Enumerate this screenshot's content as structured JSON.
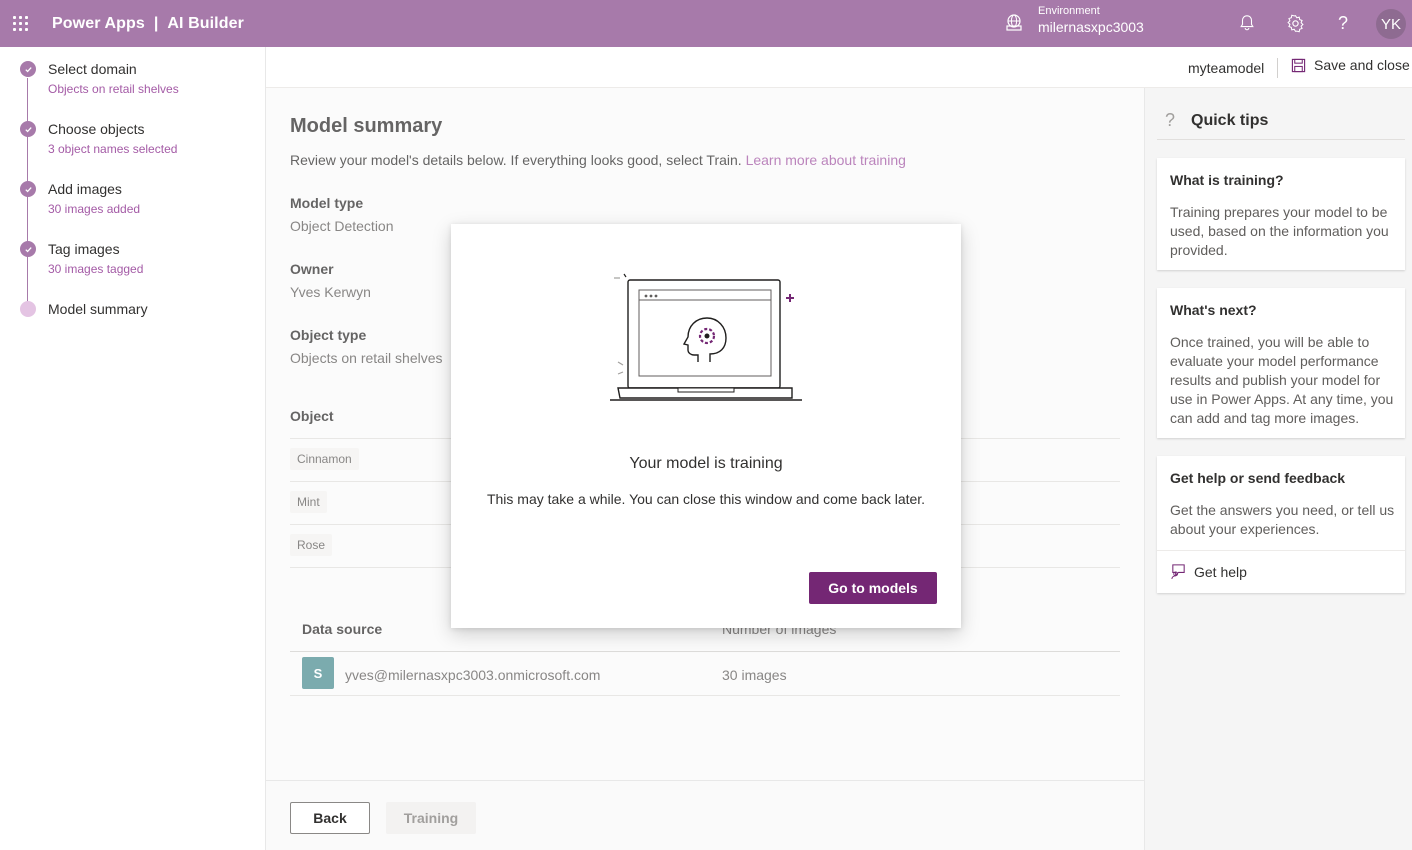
{
  "topbar": {
    "app_name": "Power Apps",
    "separator": "|",
    "product": "AI Builder",
    "environment_label": "Environment",
    "environment_value": "milernasxpc3003",
    "avatar_initials": "YK",
    "color": "#a77aaa"
  },
  "steps": [
    {
      "title": "Select domain",
      "subtitle": "Objects on retail shelves",
      "status": "done"
    },
    {
      "title": "Choose objects",
      "subtitle": "3 object names selected",
      "status": "done"
    },
    {
      "title": "Add images",
      "subtitle": "30 images added",
      "status": "done"
    },
    {
      "title": "Tag images",
      "subtitle": "30 images tagged",
      "status": "done"
    },
    {
      "title": "Model summary",
      "subtitle": "",
      "status": "current"
    }
  ],
  "header": {
    "model_name": "myteamodel",
    "save_close": "Save and close"
  },
  "summary": {
    "title": "Model summary",
    "description": "Review your model's details below. If everything looks good, select Train.",
    "learn_more": "Learn more about training",
    "model_type_label": "Model type",
    "model_type_value": "Object Detection",
    "owner_label": "Owner",
    "owner_value": "Yves Kerwyn",
    "object_type_label": "Object type",
    "object_type_value": "Objects on retail shelves",
    "object_header": "Object",
    "objects": [
      "Cinnamon",
      "Mint",
      "Rose"
    ],
    "data_source_label": "Data source",
    "num_images_label": "Number of images",
    "data_source_value": "yves@milernasxpc3003.onmicrosoft.com",
    "num_images_value": "30 images",
    "sp_icon_letter": "S"
  },
  "footer": {
    "back": "Back",
    "training": "Training"
  },
  "tips": {
    "heading": "Quick tips",
    "icon": "?",
    "cards": [
      {
        "title": "What is training?",
        "body": "Training prepares your model to be used, based on the information you provided."
      },
      {
        "title": "What's next?",
        "body": "Once trained, you will be able to evaluate your model performance results and publish your model for use in Power Apps. At any time, you can add and tag more images."
      },
      {
        "title": "Get help or send feedback",
        "body": "Get the answers you need, or tell us about your experiences.",
        "link": "Get help"
      }
    ]
  },
  "dialog": {
    "title": "Your model is training",
    "message": "This may take a while. You can close this window and come back later.",
    "button": "Go to models",
    "button_color": "#742774"
  }
}
